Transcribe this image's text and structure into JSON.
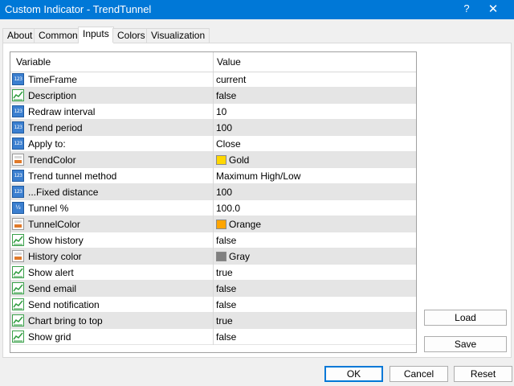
{
  "window": {
    "title": "Custom Indicator - TrendTunnel",
    "help_glyph": "?",
    "close_glyph": "✕"
  },
  "tabs": [
    {
      "label": "About"
    },
    {
      "label": "Common"
    },
    {
      "label": "Inputs",
      "active": true
    },
    {
      "label": "Colors"
    },
    {
      "label": "Visualization"
    }
  ],
  "grid": {
    "headers": {
      "variable": "Variable",
      "value": "Value"
    },
    "rows": [
      {
        "icon": "number-icon",
        "name": "TimeFrame",
        "value": "current"
      },
      {
        "icon": "boolean-icon",
        "name": "Description",
        "value": "false"
      },
      {
        "icon": "number-icon",
        "name": "Redraw interval",
        "value": "10"
      },
      {
        "icon": "number-icon",
        "name": "Trend period",
        "value": "100"
      },
      {
        "icon": "number-icon",
        "name": "Apply to:",
        "value": "Close"
      },
      {
        "icon": "color-icon",
        "name": "TrendColor",
        "value": "Gold",
        "swatch": "#ffd700"
      },
      {
        "icon": "number-icon",
        "name": "Trend tunnel method",
        "value": "Maximum High/Low"
      },
      {
        "icon": "number-icon",
        "name": "...Fixed distance",
        "value": "100"
      },
      {
        "icon": "fraction-icon",
        "name": "Tunnel %",
        "value": "100.0"
      },
      {
        "icon": "color-icon",
        "name": "TunnelColor",
        "value": "Orange",
        "swatch": "#ffa500"
      },
      {
        "icon": "boolean-icon",
        "name": "Show history",
        "value": "false"
      },
      {
        "icon": "color-icon",
        "name": "History color",
        "value": "Gray",
        "swatch": "#808080"
      },
      {
        "icon": "boolean-icon",
        "name": "Show alert",
        "value": "true"
      },
      {
        "icon": "boolean-icon",
        "name": "Send email",
        "value": "false"
      },
      {
        "icon": "boolean-icon",
        "name": "Send notification",
        "value": "false"
      },
      {
        "icon": "boolean-icon",
        "name": "Chart bring to top",
        "value": "true"
      },
      {
        "icon": "boolean-icon",
        "name": "Show grid",
        "value": "false"
      }
    ]
  },
  "icon_text": {
    "number": "123",
    "fraction": "½"
  },
  "buttons": {
    "load": "Load",
    "save": "Save",
    "ok": "OK",
    "cancel": "Cancel",
    "reset": "Reset"
  },
  "colors": {
    "titlebar": "#0078d7",
    "primary_border": "#0078d7"
  }
}
